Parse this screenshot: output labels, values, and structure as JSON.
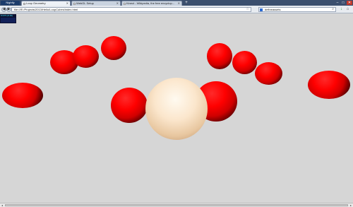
{
  "browser": {
    "menu_label": "Nightly",
    "tabs": [
      {
        "label": "Loop Geometry",
        "active": true
      },
      {
        "label": "WebGL Setup",
        "active": false
      },
      {
        "label": "Kinect - Wikipedia, the free encyclop...",
        "active": false
      }
    ],
    "new_tab": "+",
    "minimize": "–",
    "restore": "□",
    "close": "✕",
    "url": "file:///E:/Projects/2013/Hello/LoopCubes/index.html",
    "search_value": "defineassets",
    "back": "◀",
    "forward": "▶",
    "star": "☆",
    "search_glyph": "⌕",
    "home_glyph": "⌂",
    "download_glyph": "↓"
  },
  "stats": {
    "fps": "8 FPS (8-60)"
  },
  "scene": {
    "background": "#d6d6d6",
    "ball_color": "#ff0000",
    "sphere_color": "#fbe6cc"
  }
}
